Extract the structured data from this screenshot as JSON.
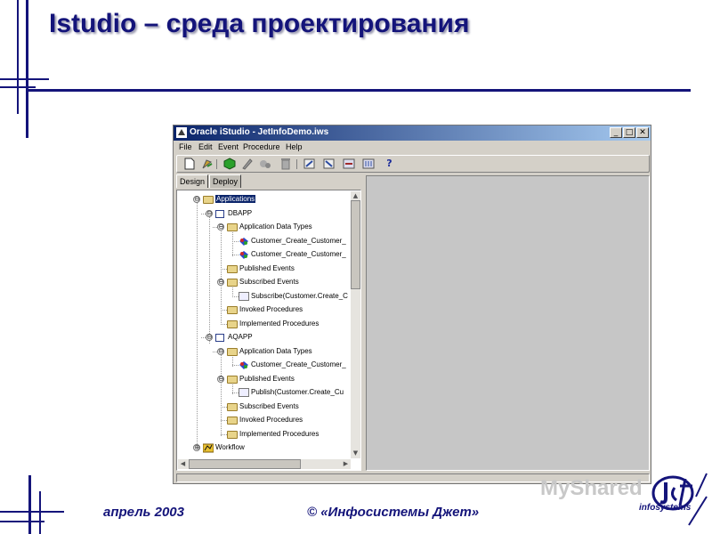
{
  "slide": {
    "title": "Istudio – среда проектирования",
    "footer_date": "апрель 2003",
    "footer_copyright": "© «Инфосистемы Джет»",
    "watermark": "MyShared",
    "logo_text": "infosystems",
    "accent_color": "#14147a"
  },
  "window": {
    "title": "Oracle iStudio - JetInfoDemo.iws",
    "controls": {
      "minimize": "_",
      "maximize": "□",
      "close": "✕"
    },
    "menu": [
      "File",
      "Edit",
      "Event",
      "Procedure",
      "Help"
    ],
    "toolbar_icons": [
      "new-file-icon",
      "open-icon",
      "cube-icon",
      "edit-icon",
      "properties-icon",
      "delete-icon",
      "import-icon",
      "export-icon",
      "deploy-icon",
      "generate-icon",
      "help-icon"
    ],
    "tabs": [
      "Design",
      "Deploy"
    ],
    "active_tab": "Design"
  },
  "tree": [
    {
      "label": "Applications",
      "toggle": "⊖",
      "icon": "folder",
      "selected": true
    },
    {
      "label": "DBAPP",
      "toggle": "⊖",
      "icon": "app"
    },
    {
      "label": "Application Data Types",
      "toggle": "⊖",
      "icon": "folder"
    },
    {
      "label": "Customer_Create_Customer_",
      "icon": "datatype"
    },
    {
      "label": "Customer_Create_Customer_",
      "icon": "datatype"
    },
    {
      "label": "Published Events",
      "icon": "folder"
    },
    {
      "label": "Subscribed Events",
      "toggle": "⊖",
      "icon": "folder"
    },
    {
      "label": "Subscribe(Customer.Create_C",
      "icon": "event"
    },
    {
      "label": "Invoked Procedures",
      "icon": "folder"
    },
    {
      "label": "Implemented Procedures",
      "icon": "folder"
    },
    {
      "label": "AQAPP",
      "toggle": "⊖",
      "icon": "app"
    },
    {
      "label": "Application Data Types",
      "toggle": "⊖",
      "icon": "folder"
    },
    {
      "label": "Customer_Create_Customer_",
      "icon": "datatype"
    },
    {
      "label": "Published Events",
      "toggle": "⊖",
      "icon": "folder"
    },
    {
      "label": "Publish(Customer.Create_Cu",
      "icon": "event"
    },
    {
      "label": "Subscribed Events",
      "icon": "folder"
    },
    {
      "label": "Invoked Procedures",
      "icon": "folder"
    },
    {
      "label": "Implemented Procedures",
      "icon": "folder"
    },
    {
      "label": "Workflow",
      "toggle": "⊕",
      "icon": "workflow"
    }
  ]
}
